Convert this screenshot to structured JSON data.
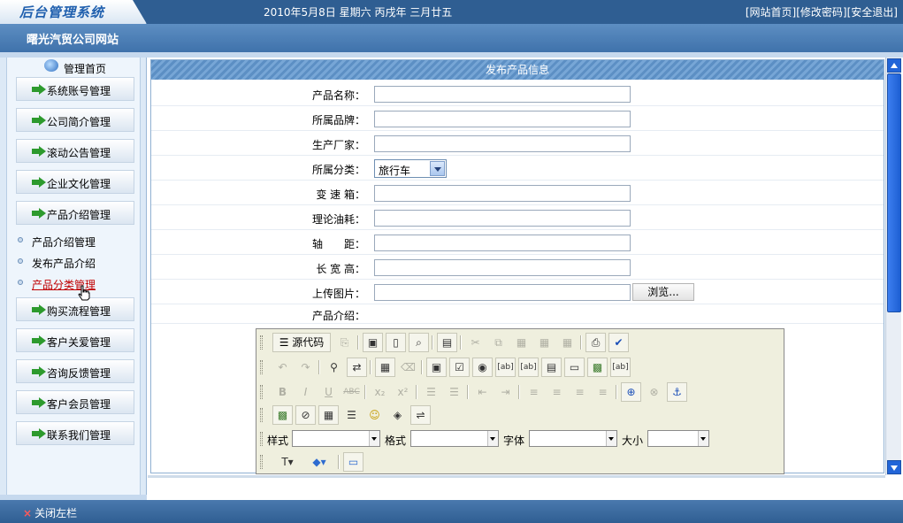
{
  "header": {
    "logo_text": "后台管理系统",
    "date_text": "2010年5月8日 星期六 丙戌年 三月廿五",
    "links": [
      "[网站首页]",
      "[修改密码]",
      "[安全退出]"
    ],
    "site_name": "曙光汽贸公司网站"
  },
  "sidebar": {
    "home_label": "管理首页",
    "menu": [
      {
        "label": "系统账号管理"
      },
      {
        "label": "公司简介管理"
      },
      {
        "label": "滚动公告管理"
      },
      {
        "label": "企业文化管理"
      },
      {
        "label": "产品介绍管理"
      },
      {
        "label": "购买流程管理"
      },
      {
        "label": "客户关爱管理"
      },
      {
        "label": "咨询反馈管理"
      },
      {
        "label": "客户会员管理"
      },
      {
        "label": "联系我们管理"
      }
    ],
    "submenu": [
      {
        "label": "产品介绍管理",
        "active": false
      },
      {
        "label": "发布产品介绍",
        "active": false
      },
      {
        "label": "产品分类管理",
        "active": true
      }
    ]
  },
  "form": {
    "title": "发布产品信息",
    "fields": [
      {
        "label": "产品名称：",
        "value": ""
      },
      {
        "label": "所属品牌：",
        "value": ""
      },
      {
        "label": "生产厂家：",
        "value": ""
      },
      {
        "label": "所属分类：",
        "value": "旅行车"
      },
      {
        "label": "变 速 箱：",
        "value": ""
      },
      {
        "label": "理论油耗：",
        "value": ""
      },
      {
        "label": "轴　　距：",
        "value": ""
      },
      {
        "label": "长 宽 高：",
        "value": ""
      },
      {
        "label": "上传图片：",
        "value": ""
      },
      {
        "label": "产品介绍：",
        "value": ""
      }
    ],
    "browse_label": "浏览..."
  },
  "editor": {
    "source_label": "源代码",
    "style_label": "样式",
    "format_label": "格式",
    "font_label": "字体",
    "size_label": "大小",
    "icons": {
      "row1": [
        "source-icon",
        "preview-doc-icon",
        "save-icon",
        "new-page-icon",
        "print-preview-icon",
        "templates-icon",
        "cut-icon",
        "copy-icon",
        "paste-icon",
        "paste-text-icon",
        "paste-word-icon",
        "print-icon",
        "spellcheck-icon"
      ],
      "row2": [
        "undo-icon",
        "redo-icon",
        "find-icon",
        "replace-icon",
        "select-all-icon",
        "remove-format-icon",
        "form-icon",
        "checkbox-icon",
        "radio-icon",
        "textfield-icon",
        "textarea-icon",
        "select-icon",
        "button-icon",
        "image-button-icon",
        "hidden-field-icon"
      ],
      "row3": [
        "bold-icon",
        "italic-icon",
        "underline-icon",
        "strike-icon",
        "subscript-icon",
        "superscript-icon",
        "ordered-list-icon",
        "unordered-list-icon",
        "outdent-icon",
        "indent-icon",
        "align-left-icon",
        "align-center-icon",
        "align-right-icon",
        "justify-icon",
        "link-icon",
        "unlink-icon",
        "anchor-icon"
      ],
      "row4": [
        "image-icon",
        "flash-icon",
        "table-icon",
        "horizontal-rule-icon",
        "smiley-icon",
        "special-char-icon",
        "page-break-icon"
      ],
      "row6": [
        "text-color-icon",
        "background-color-icon",
        "show-blocks-icon"
      ]
    }
  },
  "footer": {
    "close_sidebar": "关闭左栏"
  }
}
